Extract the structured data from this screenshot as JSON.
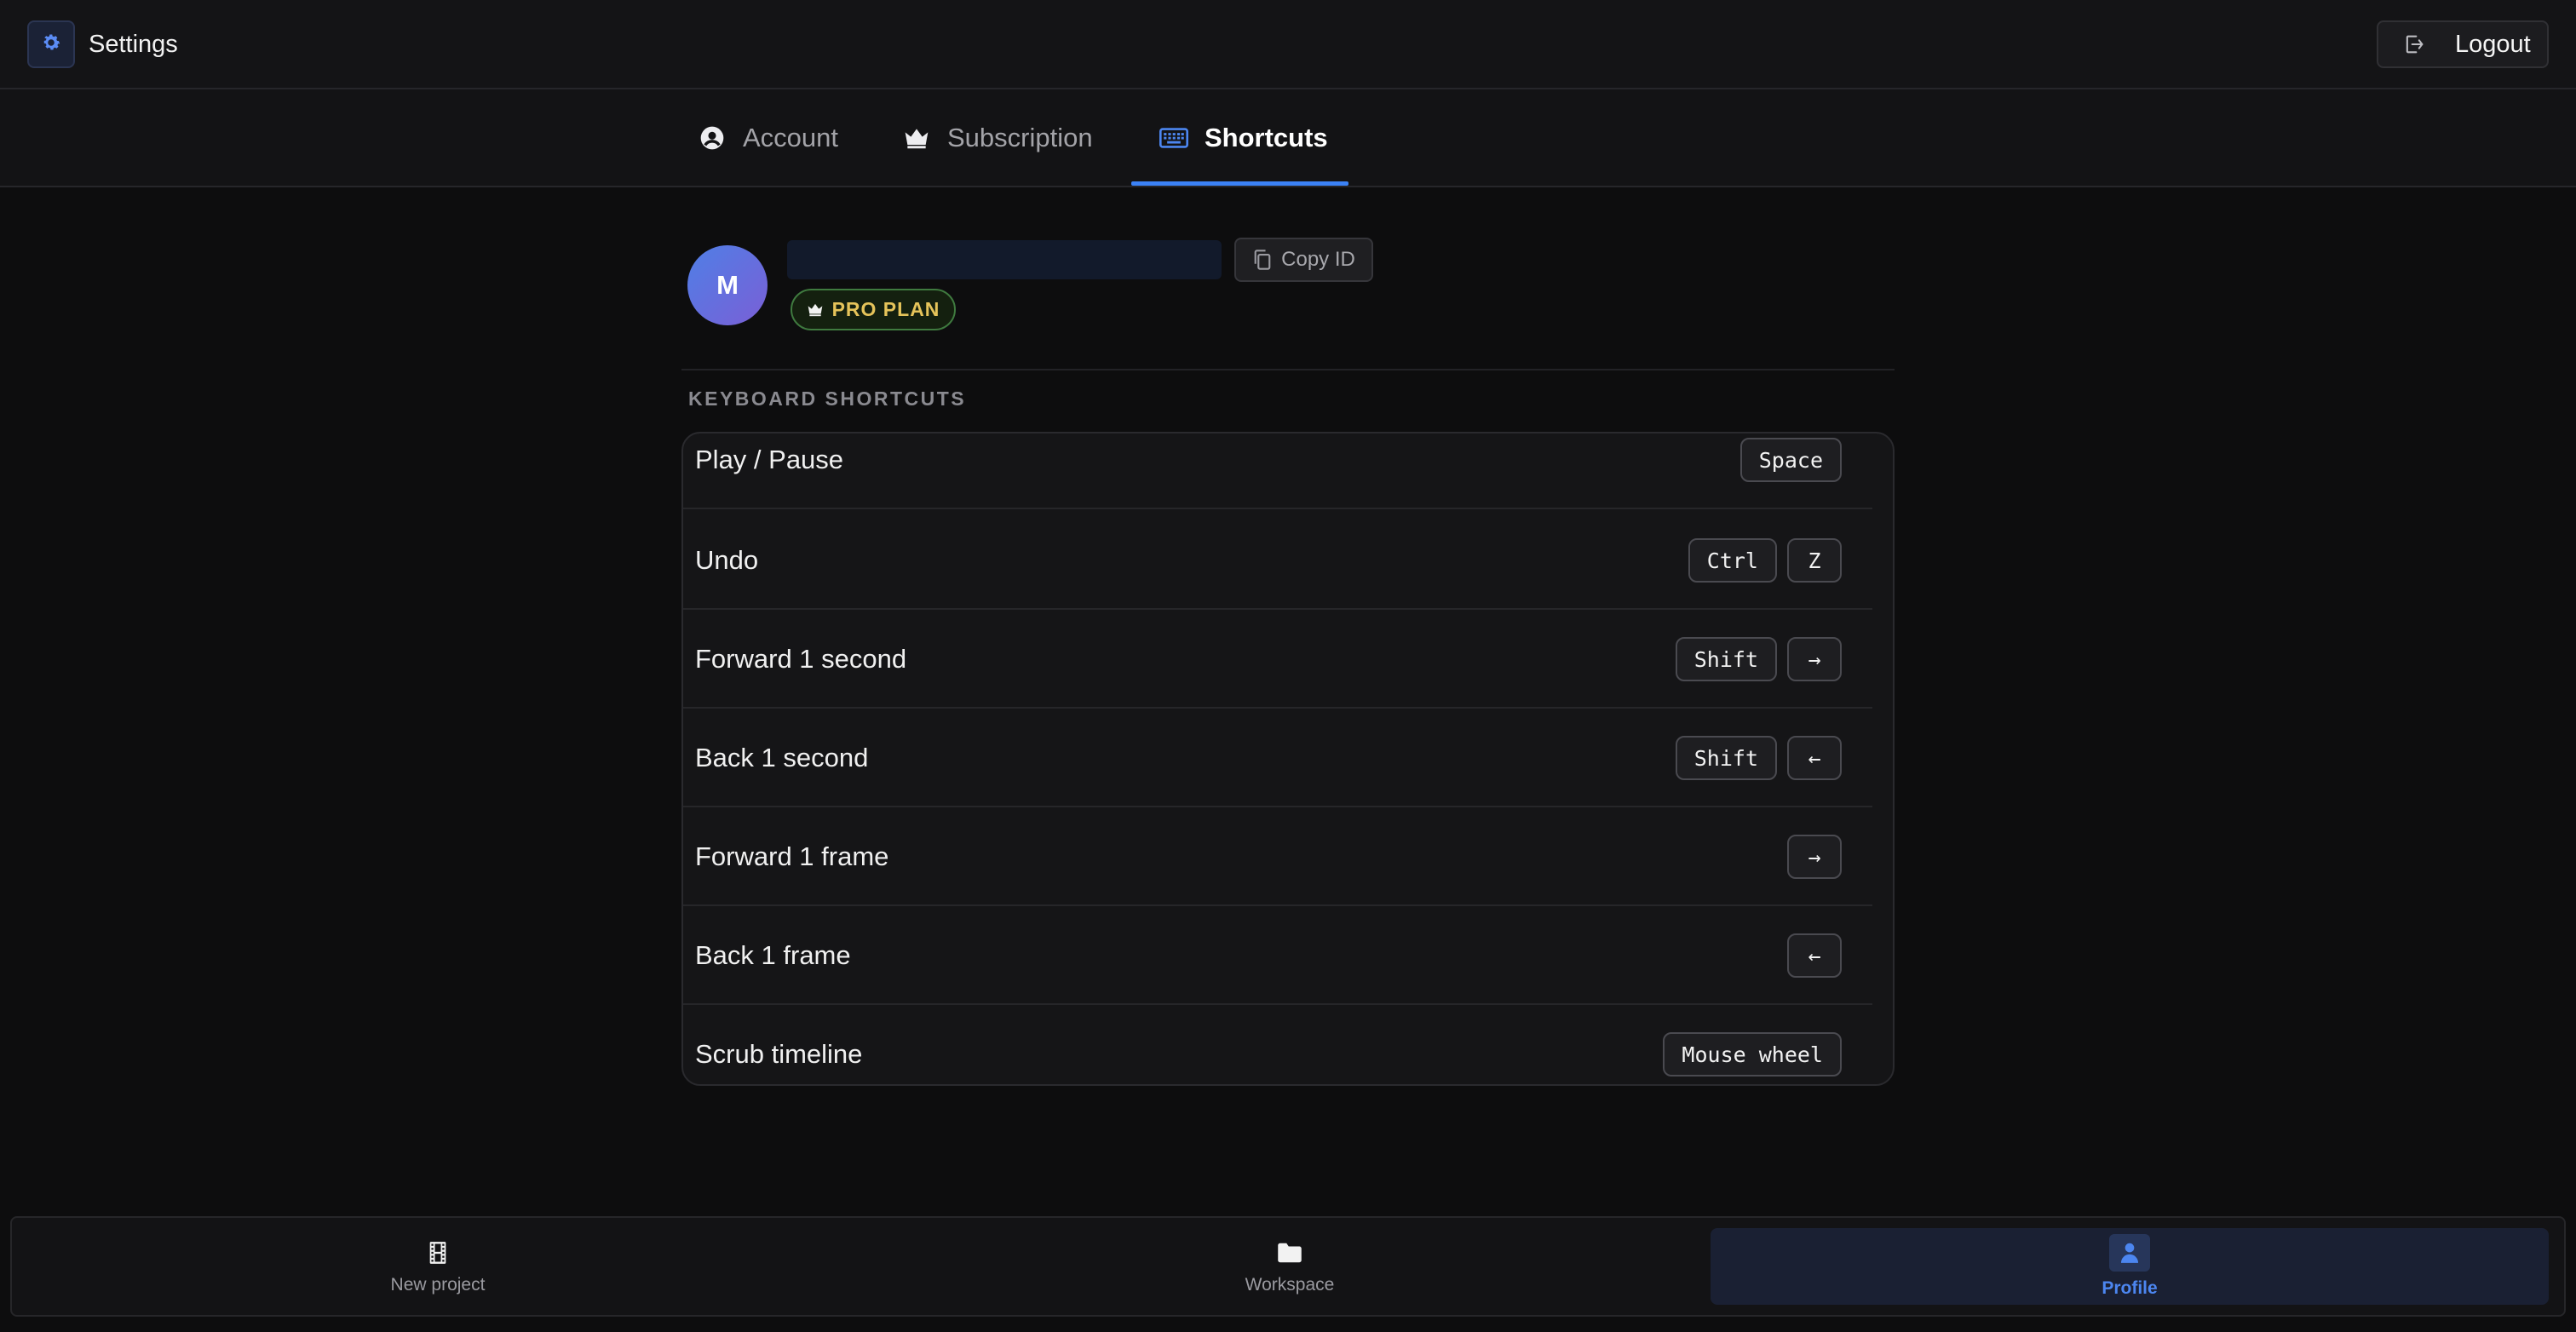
{
  "header": {
    "title": "Settings",
    "logout_label": "Logout"
  },
  "tabs": [
    {
      "label": "Account",
      "icon": "user-circle-icon",
      "active": false
    },
    {
      "label": "Subscription",
      "icon": "crown-icon",
      "active": false
    },
    {
      "label": "Shortcuts",
      "icon": "keyboard-icon",
      "active": true
    }
  ],
  "profile": {
    "avatar_initial": "M",
    "user_id_value": "",
    "copy_id_label": "Copy ID",
    "plan_badge": "PRO PLAN"
  },
  "shortcuts": {
    "section_title": "KEYBOARD SHORTCUTS",
    "rows": [
      {
        "label": "Play / Pause",
        "keys": [
          "Space"
        ]
      },
      {
        "label": "Undo",
        "keys": [
          "Ctrl",
          "Z"
        ]
      },
      {
        "label": "Forward 1 second",
        "keys": [
          "Shift",
          "→"
        ]
      },
      {
        "label": "Back 1 second",
        "keys": [
          "Shift",
          "←"
        ]
      },
      {
        "label": "Forward 1 frame",
        "keys": [
          "→"
        ]
      },
      {
        "label": "Back 1 frame",
        "keys": [
          "←"
        ]
      },
      {
        "label": "Scrub timeline",
        "keys": [
          "Mouse wheel"
        ]
      }
    ]
  },
  "bottom_nav": [
    {
      "label": "New project",
      "icon": "film-icon",
      "active": false
    },
    {
      "label": "Workspace",
      "icon": "folder-icon",
      "active": false
    },
    {
      "label": "Profile",
      "icon": "user-icon",
      "active": true
    }
  ],
  "colors": {
    "accent": "#3b82f6",
    "plan_text": "#e5c35a",
    "plan_border": "#3f7a3f",
    "background": "#0d0d0e"
  }
}
